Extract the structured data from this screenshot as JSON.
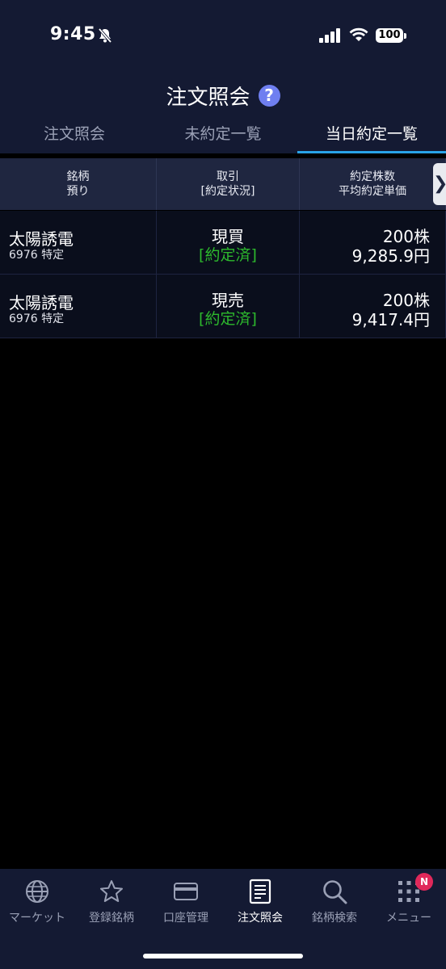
{
  "status_bar": {
    "time": "9:45",
    "battery": "100"
  },
  "header": {
    "title": "注文照会",
    "help": "?",
    "tabs": [
      {
        "label": "注文照会"
      },
      {
        "label": "未約定一覧"
      },
      {
        "label": "当日約定一覧"
      }
    ]
  },
  "table": {
    "columns": [
      {
        "line1": "銘柄",
        "line2": "預り"
      },
      {
        "line1": "取引",
        "line2": "[約定状況]"
      },
      {
        "line1": "約定株数",
        "line2": "平均約定単価"
      }
    ],
    "scroll_arrow": "❯",
    "rows": [
      {
        "name": "太陽誘電",
        "code": "6976 特定",
        "trade": "現買",
        "status": "[約定済]",
        "qty": "200株",
        "price": "9,285.9円"
      },
      {
        "name": "太陽誘電",
        "code": "6976 特定",
        "trade": "現売",
        "status": "[約定済]",
        "qty": "200株",
        "price": "9,417.4円"
      }
    ]
  },
  "bottom_nav": {
    "items": [
      {
        "label": "マーケット",
        "icon": "globe-icon"
      },
      {
        "label": "登録銘柄",
        "icon": "star-icon"
      },
      {
        "label": "口座管理",
        "icon": "card-icon"
      },
      {
        "label": "注文照会",
        "icon": "document-icon"
      },
      {
        "label": "銘柄検索",
        "icon": "search-icon"
      },
      {
        "label": "メニュー",
        "icon": "grid-icon"
      }
    ],
    "badge": "N"
  },
  "colors": {
    "accent": "#29a3e8",
    "executed": "#2db92d",
    "badge": "#e0285a",
    "help": "#6f7ff0"
  }
}
